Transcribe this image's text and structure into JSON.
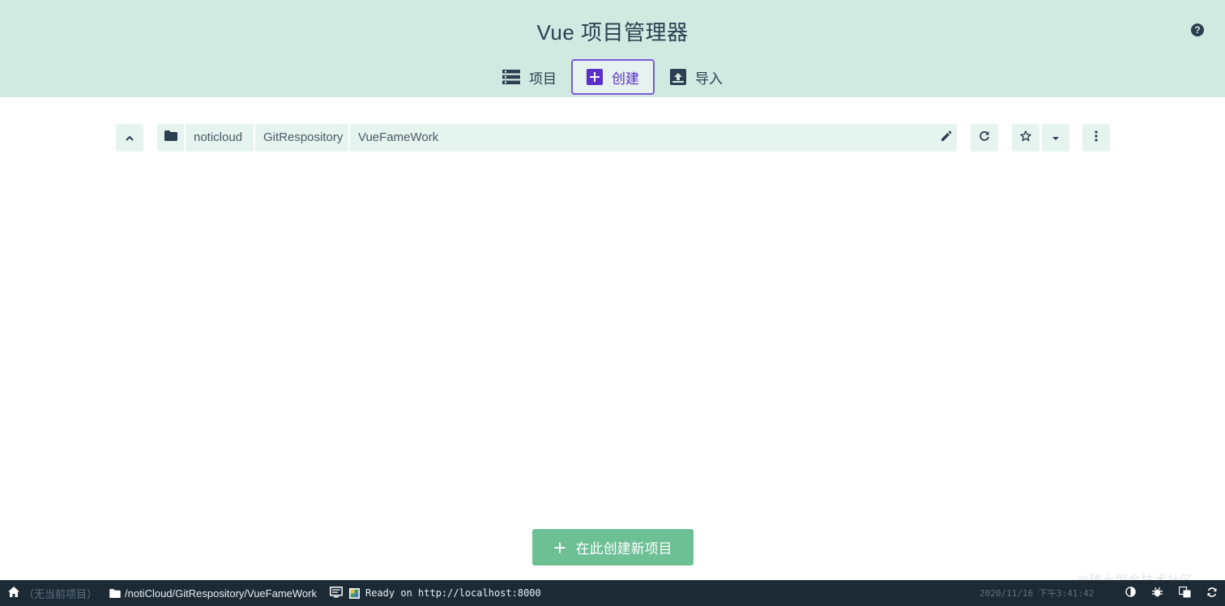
{
  "header": {
    "title": "Vue 项目管理器",
    "help_icon": "question-circle-icon",
    "tabs": [
      {
        "label": "项目",
        "icon": "list-icon"
      },
      {
        "label": "创建",
        "icon": "add-box-icon"
      },
      {
        "label": "导入",
        "icon": "unarchive-icon"
      }
    ]
  },
  "explorer": {
    "path_segments": [
      "noticloud",
      "GitRespository",
      "VueFameWork"
    ],
    "buttons": [
      "chevron-up-icon",
      "folder-icon",
      "edit-icon",
      "refresh-icon",
      "star-icon",
      "dropdown-icon",
      "more-vert-icon"
    ]
  },
  "create_button": {
    "label": "在此创建新项目"
  },
  "statusbar": {
    "no_project": "（无当前项目）",
    "path": "/notiCloud/GitRespository/VueFameWork",
    "ready": "Ready on http://localhost:8000",
    "datetime": "2020/11/16 下午3:41:42",
    "watermark": "@稀土掘金技术社区"
  },
  "colors": {
    "header_bg": "#d0e9e1",
    "accent_purple": "#5a2ec9",
    "create_green": "#6dbf94",
    "statusbar_bg": "#1c2a36",
    "pathbar_bg": "#e5f4ee"
  }
}
